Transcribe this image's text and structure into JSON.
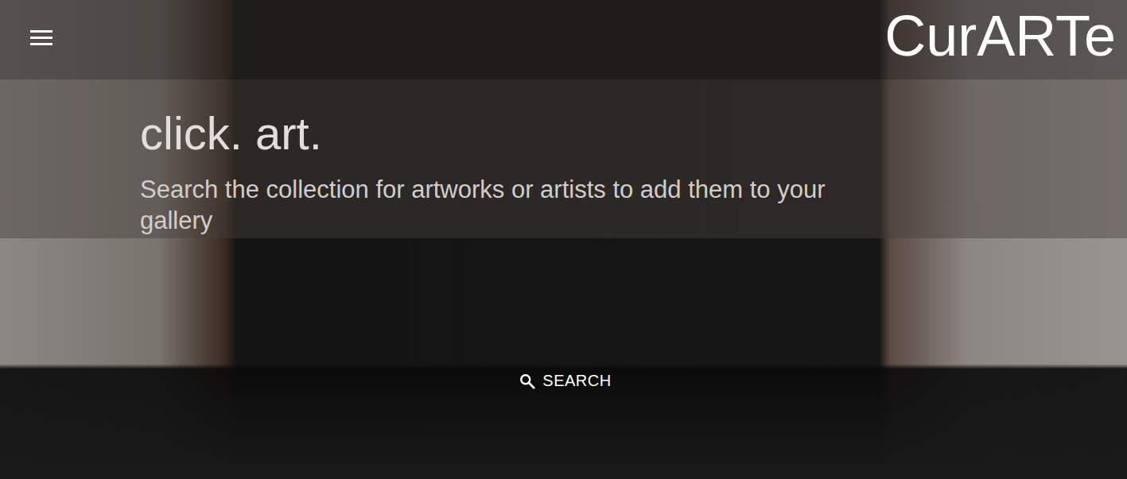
{
  "header": {
    "logo": "CurARTe"
  },
  "hero": {
    "title": "click. art.",
    "subtitle": "Search the collection for artworks or artists to add them to your gallery"
  },
  "search": {
    "label": "SEARCH"
  }
}
